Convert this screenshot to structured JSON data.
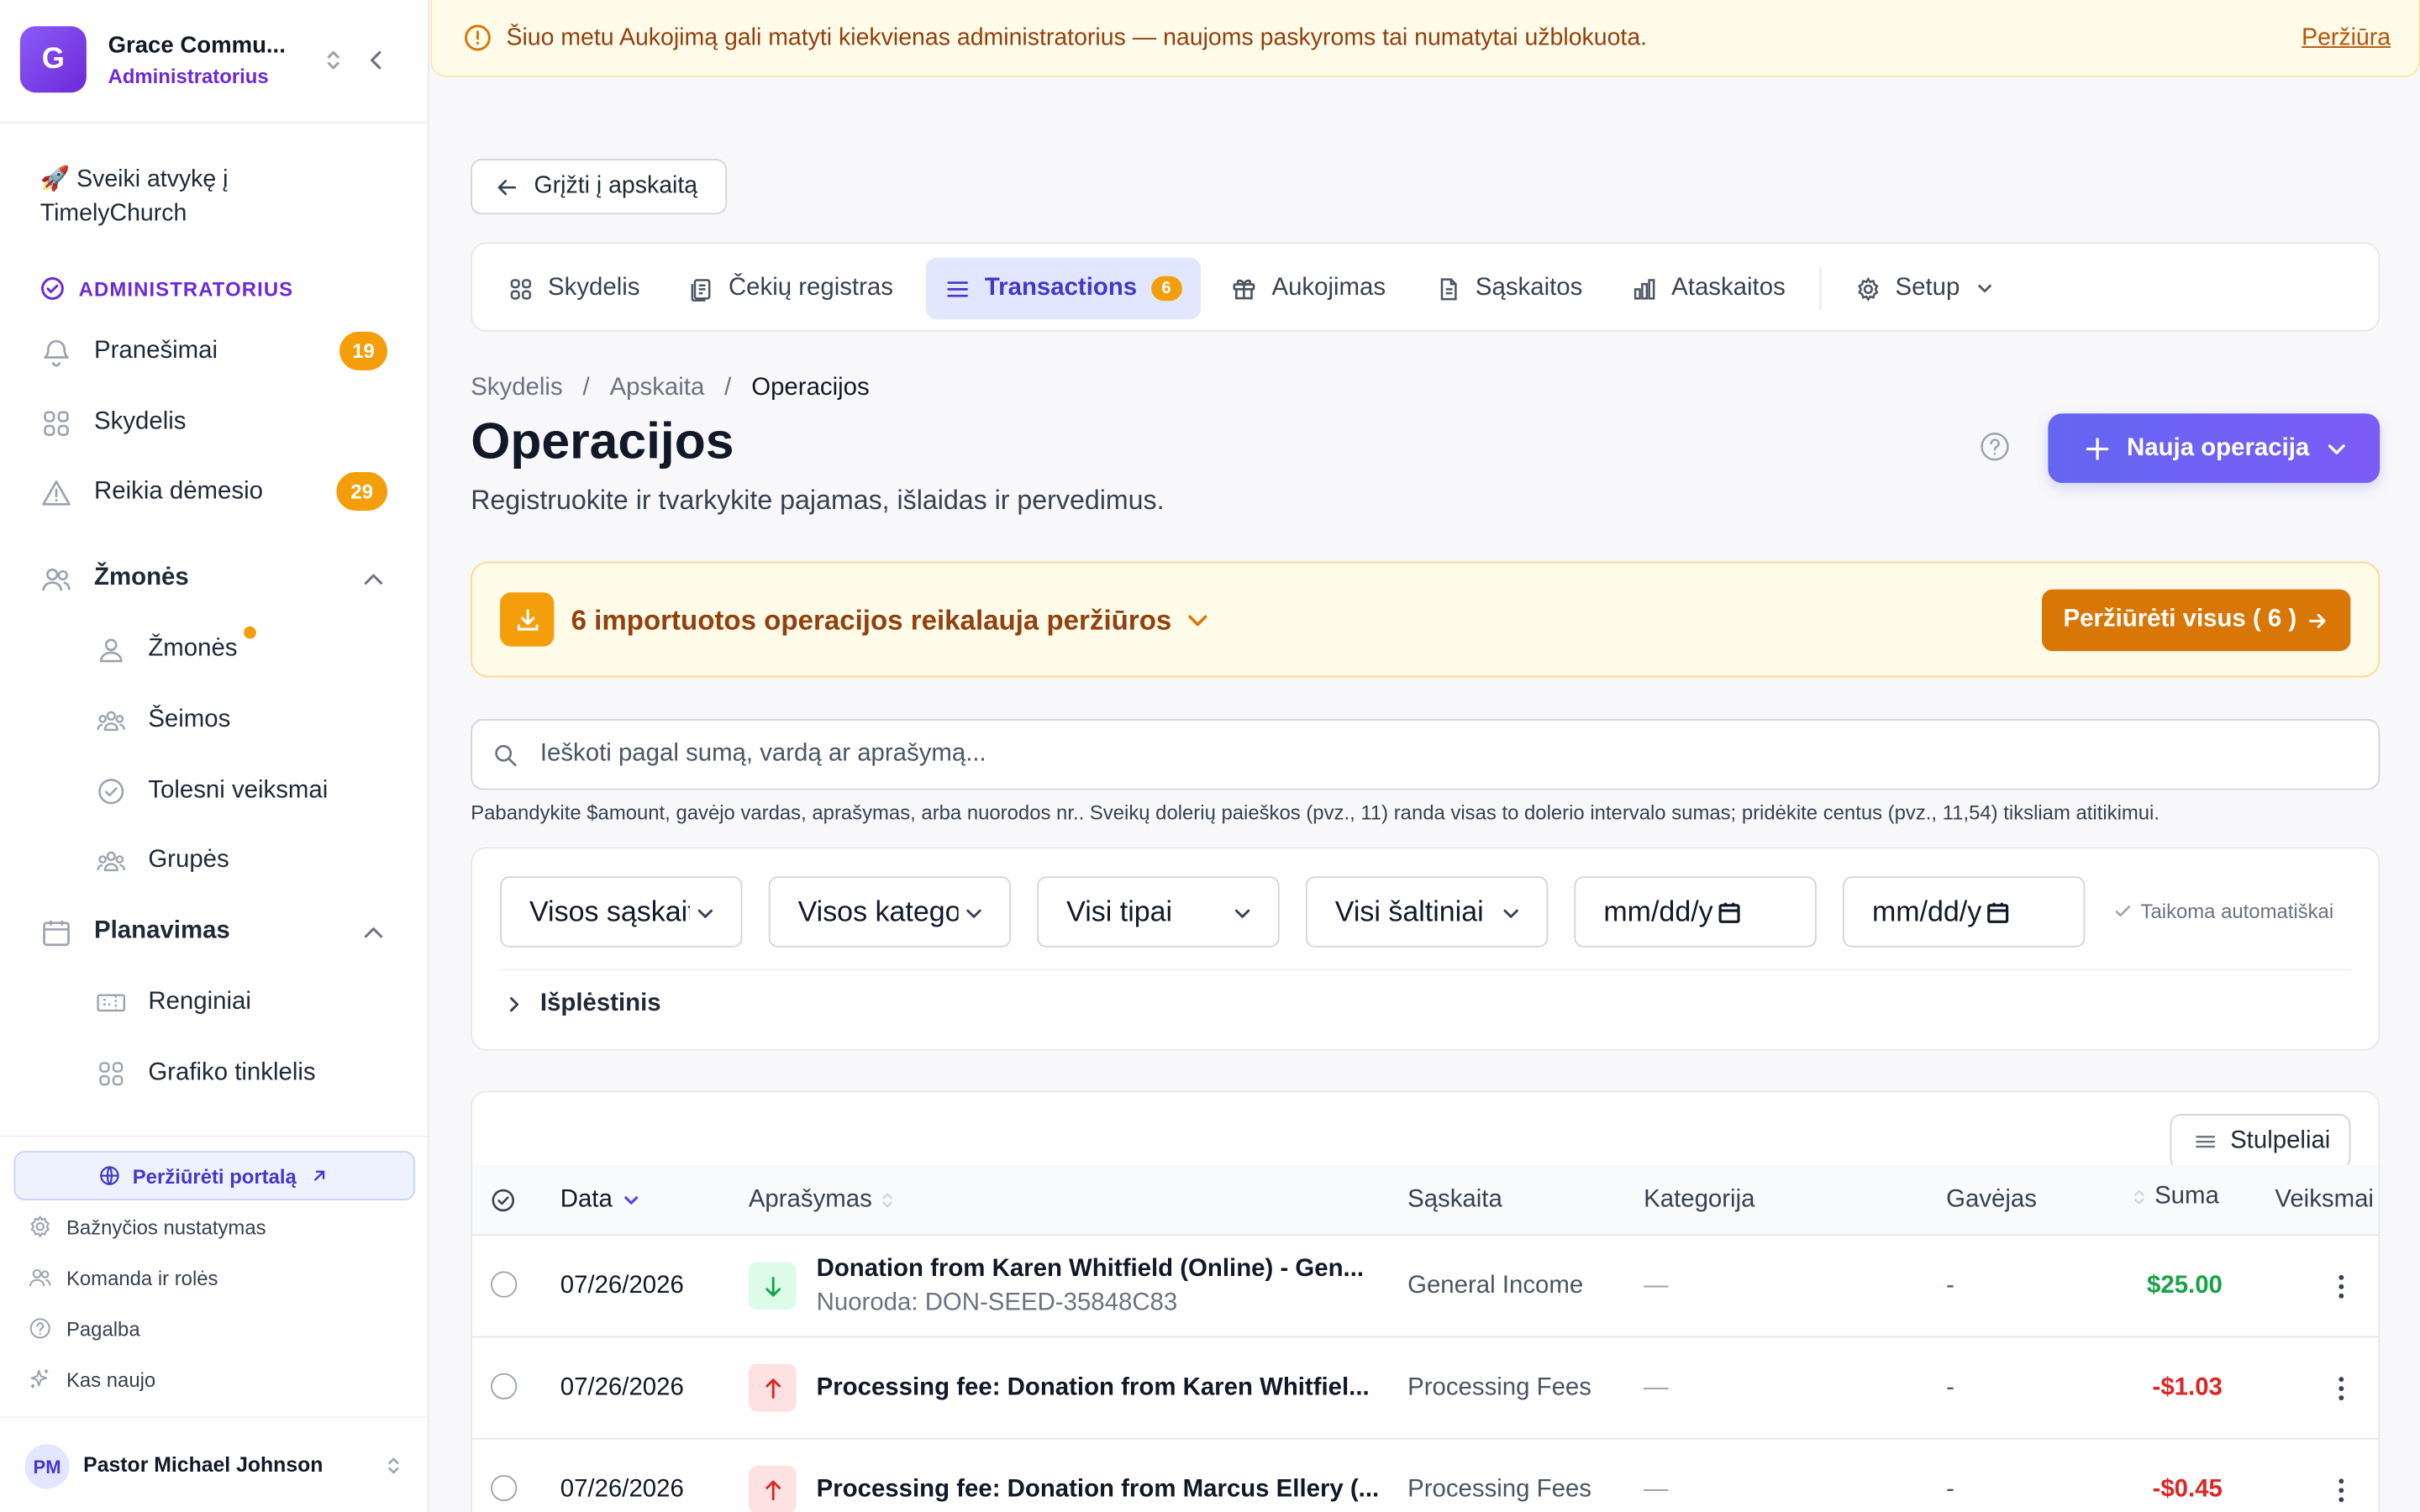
{
  "org": {
    "initial": "G",
    "name": "Grace Commu...",
    "role": "Administratorius"
  },
  "sidebar": {
    "welcome": "🚀 Sveiki atvykę į TimelyChurch",
    "admin_section": "ADMINISTRATORIUS",
    "items": [
      {
        "label": "Pranešimai",
        "icon": "bell-icon",
        "badge": "19"
      },
      {
        "label": "Skydelis",
        "icon": "grid-icon"
      },
      {
        "label": "Reikia dėmesio",
        "icon": "warning-icon",
        "badge": "29"
      },
      {
        "label": "Žmonės",
        "icon": "people-icon",
        "expanded": true
      },
      {
        "label": "Žmonės",
        "icon": "person-icon",
        "dot": true
      },
      {
        "label": "Šeimos",
        "icon": "family-icon"
      },
      {
        "label": "Tolesni veiksmai",
        "icon": "check-circle-icon"
      },
      {
        "label": "Grupės",
        "icon": "groups-icon"
      },
      {
        "label": "Planavimas",
        "icon": "calendar-icon",
        "expanded": true
      },
      {
        "label": "Renginiai",
        "icon": "ticket-icon"
      },
      {
        "label": "Grafiko tinklelis",
        "icon": "grid-icon"
      }
    ],
    "portal_button": "Peržiūrėti portalą",
    "footer": [
      {
        "label": "Bažnyčios nustatymas",
        "icon": "gear-icon"
      },
      {
        "label": "Komanda ir rolės",
        "icon": "team-icon"
      },
      {
        "label": "Pagalba",
        "icon": "help-icon"
      },
      {
        "label": "Kas naujo",
        "icon": "sparkle-icon"
      }
    ],
    "user": {
      "initials": "PM",
      "name": "Pastor Michael Johnson"
    }
  },
  "banner": {
    "text": "Šiuo metu Aukojimą gali matyti kiekvienas administratorius — naujoms paskyroms tai numatytai užblokuota.",
    "link": "Peržiūra"
  },
  "back_button": "Grįžti į apskaitą",
  "tabs": [
    {
      "label": "Skydelis",
      "icon": "grid-icon"
    },
    {
      "label": "Čekių registras",
      "icon": "receipt-icon"
    },
    {
      "label": "Transactions",
      "icon": "list-icon",
      "badge": "6",
      "active": true
    },
    {
      "label": "Aukojimas",
      "icon": "gift-icon"
    },
    {
      "label": "Sąskaitos",
      "icon": "document-icon"
    },
    {
      "label": "Ataskaitos",
      "icon": "bar-chart-icon"
    },
    {
      "label": "Setup",
      "icon": "gear-icon"
    }
  ],
  "breadcrumb": [
    "Skydelis",
    "Apskaita",
    "Operacijos"
  ],
  "page": {
    "title": "Operacijos",
    "subtitle": "Registruokite ir tvarkykite pajamas, išlaidas ir pervedimus.",
    "new_button": "Nauja operacija"
  },
  "import_banner": {
    "text": "6 importuotos operacijos reikalauja peržiūros",
    "button": "Peržiūrėti visus ( 6 )"
  },
  "search": {
    "placeholder": "Ieškoti pagal sumą, vardą ar aprašymą...",
    "hint": "Pabandykite $amount, gavėjo vardas, aprašymas, arba nuorodos nr.. Sveikų dolerių paieškos (pvz., 11) randa visas to dolerio intervalo sumas; pridėkite centus (pvz., 11,54) tiksliam atitikimui."
  },
  "filters": {
    "accounts": "Visos sąskaitos",
    "categories": "Visos kategorijos",
    "types": "Visi tipai",
    "sources": "Visi šaltiniai",
    "date_from": "mm/dd/y",
    "date_to": "mm/dd/y",
    "auto_apply": "Taikoma automatiškai",
    "advanced": "Išplėstinis"
  },
  "table": {
    "columns_button": "Stulpeliai",
    "headers": {
      "date": "Data",
      "description": "Aprašymas",
      "account": "Sąskaita",
      "category": "Kategorija",
      "payee": "Gavėjas",
      "amount": "Suma",
      "actions": "Veiksmai"
    },
    "rows": [
      {
        "date": "07/26/2026",
        "direction": "in",
        "description": "Donation from Karen Whitfield (Online) - Gen...",
        "ref": "Nuoroda: DON-SEED-35848C83",
        "account": "General Income",
        "category": "—",
        "payee": "-",
        "amount": "$25.00"
      },
      {
        "date": "07/26/2026",
        "direction": "out",
        "description": "Processing fee: Donation from Karen Whitfiel...",
        "ref": "",
        "account": "Processing Fees",
        "category": "—",
        "payee": "-",
        "amount": "-$1.03"
      },
      {
        "date": "07/26/2026",
        "direction": "out",
        "description": "Processing fee: Donation from Marcus Ellery (...",
        "ref": "",
        "account": "Processing Fees",
        "category": "—",
        "payee": "-",
        "amount": "-$0.45"
      }
    ]
  },
  "colors": {
    "accent": "#6366f1",
    "warning": "#f59e0b",
    "positive": "#16a34a",
    "negative": "#dc2626"
  }
}
